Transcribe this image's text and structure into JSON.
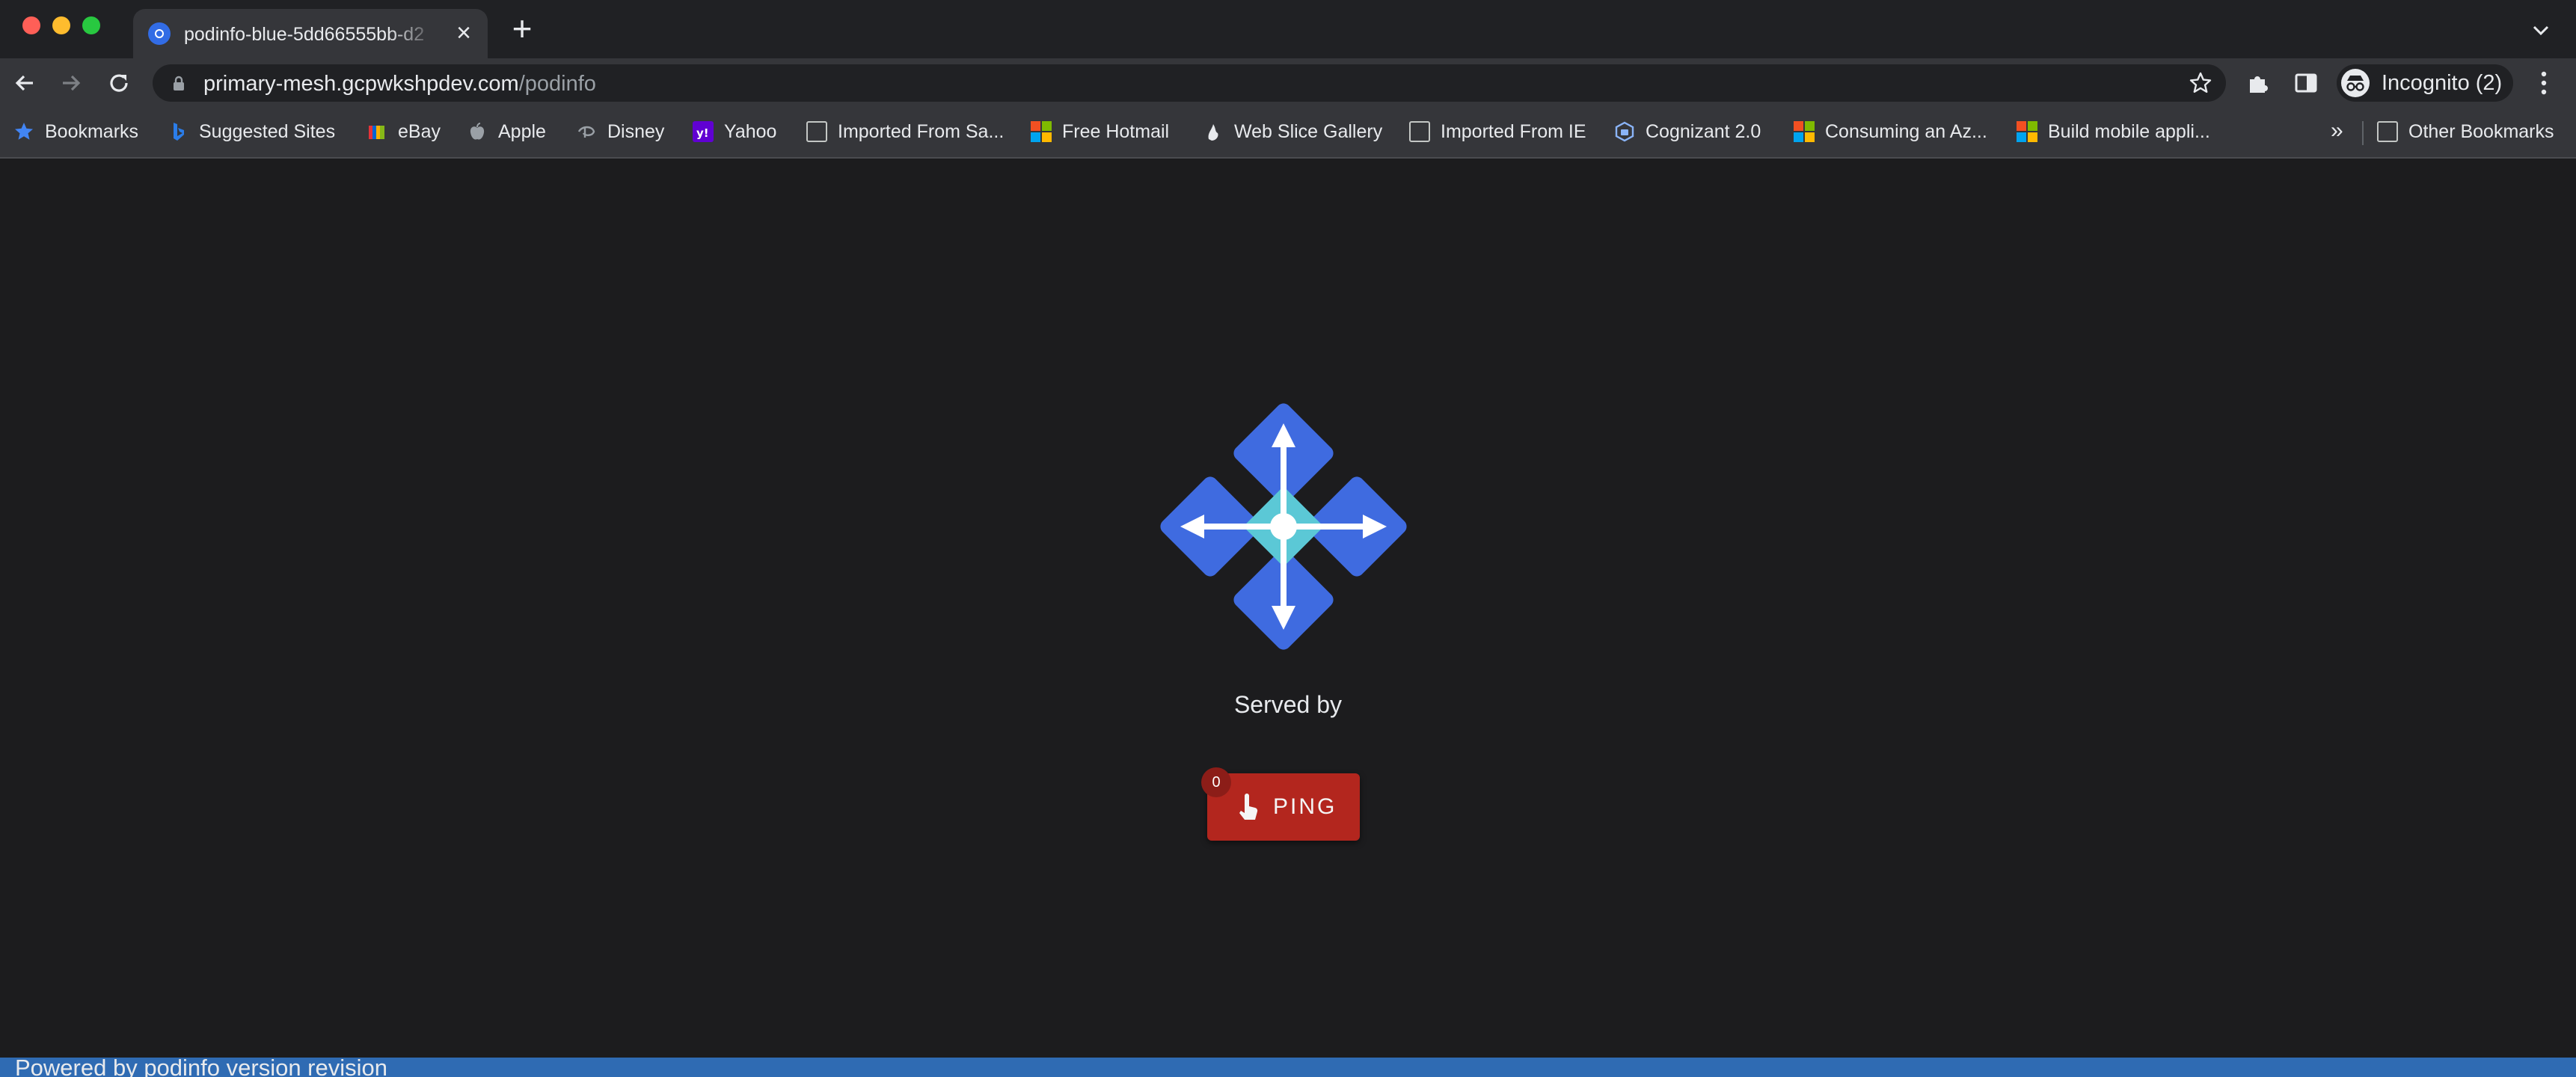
{
  "browser": {
    "tab": {
      "title": "podinfo-blue-5dd66555bb-d2",
      "favicon": "kubernetes-icon"
    },
    "address_bar": {
      "host": "primary-mesh.gcpwkshpdev.com",
      "path": "/podinfo"
    },
    "profile": {
      "label": "Incognito (2)"
    }
  },
  "bookmarks_bar": {
    "items": [
      {
        "label": "Bookmarks",
        "icon": "star-icon"
      },
      {
        "label": "Suggested Sites",
        "icon": "bing-icon"
      },
      {
        "label": "eBay",
        "icon": "ebay-icon"
      },
      {
        "label": "Apple",
        "icon": "apple-icon"
      },
      {
        "label": "Disney",
        "icon": "disney-icon"
      },
      {
        "label": "Yahoo",
        "icon": "yahoo-icon"
      },
      {
        "label": "Imported From Sa...",
        "icon": "folder-icon"
      },
      {
        "label": "Free Hotmail",
        "icon": "microsoft-icon"
      },
      {
        "label": "Web Slice Gallery",
        "icon": "webslice-icon"
      },
      {
        "label": "Imported From IE",
        "icon": "folder-icon"
      },
      {
        "label": "Cognizant 2.0",
        "icon": "cognizant-icon"
      },
      {
        "label": "Consuming an Az...",
        "icon": "microsoft-icon"
      },
      {
        "label": "Build mobile appli...",
        "icon": "microsoft-icon"
      }
    ],
    "overflow_label": "»",
    "other_bookmarks": "Other Bookmarks"
  },
  "page": {
    "logo": "podinfo-logo",
    "served_by": "Served by",
    "ping_button": {
      "label": "PING",
      "count": "0"
    },
    "footer": "Powered by podinfo version revision"
  },
  "colors": {
    "page_background": "#1c1c1e",
    "logo_blue": "#3f6be0",
    "logo_teal": "#5bc8d6",
    "ping_red": "#b3261e",
    "footer_blue": "#2f6bb3"
  }
}
